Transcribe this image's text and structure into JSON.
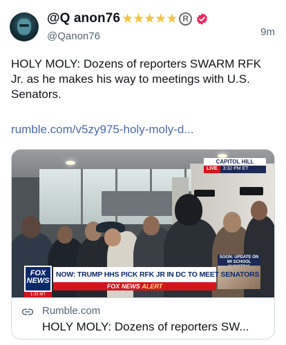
{
  "post": {
    "display_name": "@Q anon76",
    "handle": "@Qanon76",
    "timestamp": "9m",
    "star_count": 5,
    "registered_symbol": "R",
    "text": "HOLY MOLY: Dozens of reporters SWARM RFK Jr. as he makes his way to meetings with U.S. Senators.",
    "link": "rumble.com/v5zy975-holy-moly-d..."
  },
  "card": {
    "domain": "Rumble.com",
    "title": "HOLY MOLY: Dozens of reporters SW...",
    "broadcast": {
      "location": "CAPITOL HILL",
      "live_label": "LIVE",
      "live_time": "3:32 PM ET",
      "network_logo_line1": "FOX",
      "network_logo_line2": "NEWS",
      "network_time": "1:32 MT",
      "headline": "NOW: TRUMP HHS PICK RFK JR IN DC TO MEET SENATORS",
      "alert_prefix": "FOX NEWS",
      "alert_word": "ALERT",
      "side_box": "SOON: UPDATE ON WI SCHOOL SHOOTING"
    }
  },
  "colors": {
    "text_primary": "#0f1419",
    "text_secondary": "#536471",
    "link": "#4a6ba8",
    "star": "#f6c343",
    "verified_badge": "#f4245e",
    "border": "#cfd9de",
    "fox_blue": "#0a2a6b",
    "fox_red": "#d3141c"
  },
  "icons": {
    "avatar": "masked-figure-avatar",
    "stars": "star-icon",
    "verified": "verified-badge-icon",
    "registered": "registered-mark-icon",
    "link": "link-chain-icon"
  }
}
